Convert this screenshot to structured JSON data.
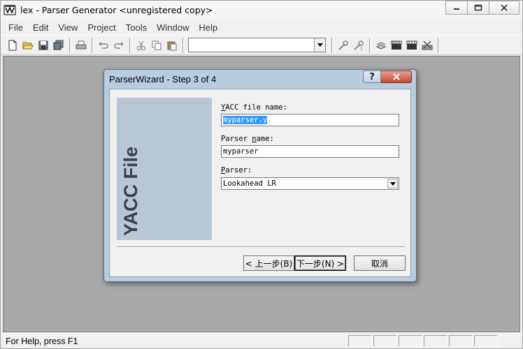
{
  "window": {
    "title": "lex - Parser Generator <unregistered copy>"
  },
  "menu": [
    "File",
    "Edit",
    "View",
    "Project",
    "Tools",
    "Window",
    "Help"
  ],
  "toolbar": {
    "combo_value": ""
  },
  "status": {
    "text": "For Help, press F1"
  },
  "dialog": {
    "title": "ParserWizard - Step 3 of 4",
    "help_label": "?",
    "side_text": "YACC File",
    "yacc_label_prefix": "",
    "yacc_label_key": "Y",
    "yacc_label_rest": "ACC file name:",
    "yacc_value": "myparser.y",
    "parser_name_label_pre": "Parser ",
    "parser_name_label_key": "n",
    "parser_name_label_rest": "ame:",
    "parser_name_value": "myparser",
    "parser_label_key": "P",
    "parser_label_rest": "arser:",
    "parser_value": "Lookahead LR",
    "back_button": "< 上一步(B)",
    "next_button": "下一步(N) >",
    "cancel_button": "取消"
  }
}
